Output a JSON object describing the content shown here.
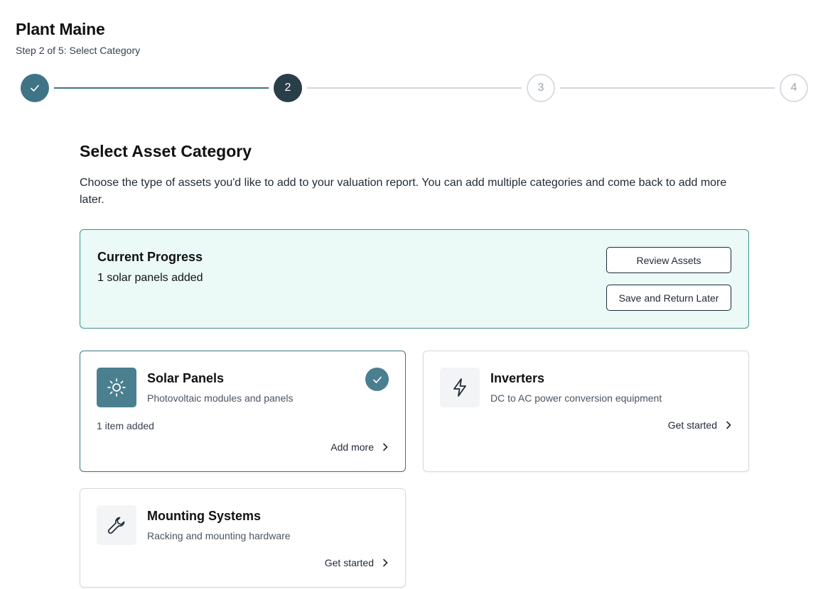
{
  "header": {
    "title": "Plant Maine",
    "subtitle": "Step 2 of 5: Select Category"
  },
  "stepper": {
    "steps": [
      {
        "label": "",
        "state": "completed"
      },
      {
        "label": "2",
        "state": "current"
      },
      {
        "label": "3",
        "state": "upcoming"
      },
      {
        "label": "4",
        "state": "upcoming"
      }
    ]
  },
  "section": {
    "title": "Select Asset Category",
    "description": "Choose the type of assets you'd like to add to your valuation report. You can add multiple categories and come back to add more later."
  },
  "progress": {
    "title": "Current Progress",
    "text": "1 solar panels added",
    "review_label": "Review Assets",
    "save_label": "Save and Return Later"
  },
  "categories": [
    {
      "title": "Solar Panels",
      "description": "Photovoltaic modules and panels",
      "status": "1 item added",
      "action": "Add more",
      "icon": "sun-icon",
      "selected": true
    },
    {
      "title": "Inverters",
      "description": "DC to AC power conversion equipment",
      "action": "Get started",
      "icon": "lightning-icon",
      "selected": false
    },
    {
      "title": "Mounting Systems",
      "description": "Racking and mounting hardware",
      "action": "Get started",
      "icon": "wrench-icon",
      "selected": false
    }
  ],
  "colors": {
    "accent": "#3f7486",
    "step_current": "#2a3e4a",
    "progress_bg": "#ebfaf6",
    "progress_border": "#3f8e8c"
  }
}
